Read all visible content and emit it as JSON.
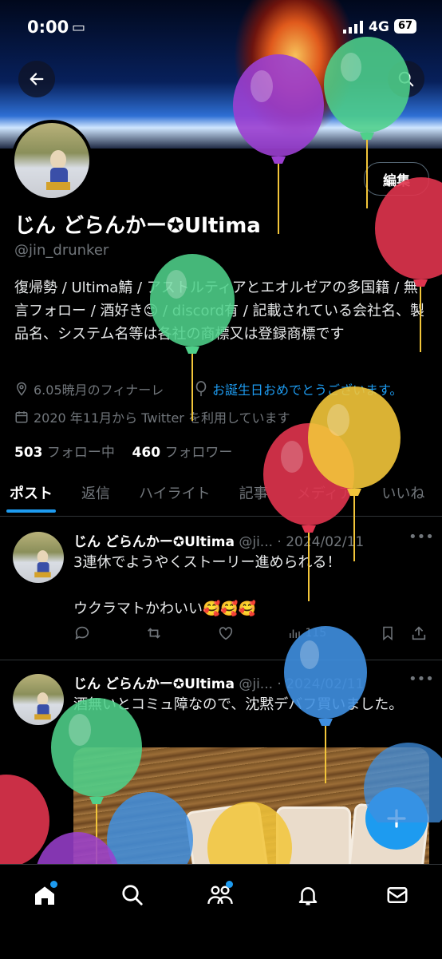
{
  "status": {
    "time": "0:00",
    "network": "4G",
    "battery": "67"
  },
  "profile": {
    "edit_label": "編集",
    "name": "じん どらんかー✪Ultima",
    "handle": "@jin_drunker",
    "bio_part1": "復帰勢 / Ultima鯖 / アストルティアとエオルゼアの多国籍 / 無言フォロー / 酒好き",
    "bio_emoji": "😊",
    "bio_part2": " / discord有 / 記載されている会社名、製品名、システム名等は各社の商標又は登録商標です",
    "location": "6.05暁月のフィナーレ",
    "birthday": "お誕生日おめでとうございます。",
    "joined": "2020 年11月から Twitter を利用しています",
    "following_count": "503",
    "following_label": "フォロー中",
    "followers_count": "460",
    "followers_label": "フォロワー"
  },
  "tabs": [
    {
      "label": "ポスト"
    },
    {
      "label": "返信"
    },
    {
      "label": "ハイライト"
    },
    {
      "label": "記事"
    },
    {
      "label": "メディア"
    },
    {
      "label": "いいね"
    }
  ],
  "posts": [
    {
      "name": "じん どらんかー✪Ultima",
      "handle": "@ji...",
      "date": "· 2024/02/11",
      "text1": "3連休でようやくストーリー進められる！",
      "text2": "ウクラマトかわいい🥰🥰🥰",
      "views": "115"
    },
    {
      "name": "じん どらんかー✪Ultima",
      "handle": "@ji...",
      "date": "· 2024/02/11",
      "text1": "酒無いとコミュ障なので、沈黙デバフ買いました。"
    }
  ],
  "colors": {
    "accent": "#1d9bf0",
    "balloon_purple": "#9b3fd0",
    "balloon_green": "#4fd08a",
    "balloon_red": "#e0344e",
    "balloon_yellow": "#f2c53a",
    "balloon_blue": "#3f8fe0"
  },
  "icons": [
    "back-arrow-icon",
    "search-icon",
    "location-pin-icon",
    "balloon-icon",
    "calendar-icon",
    "reply-icon",
    "repost-icon",
    "like-icon",
    "views-icon",
    "bookmark-icon",
    "share-icon",
    "compose-plus-icon",
    "home-icon",
    "explore-icon",
    "communities-icon",
    "notifications-icon",
    "messages-icon"
  ]
}
